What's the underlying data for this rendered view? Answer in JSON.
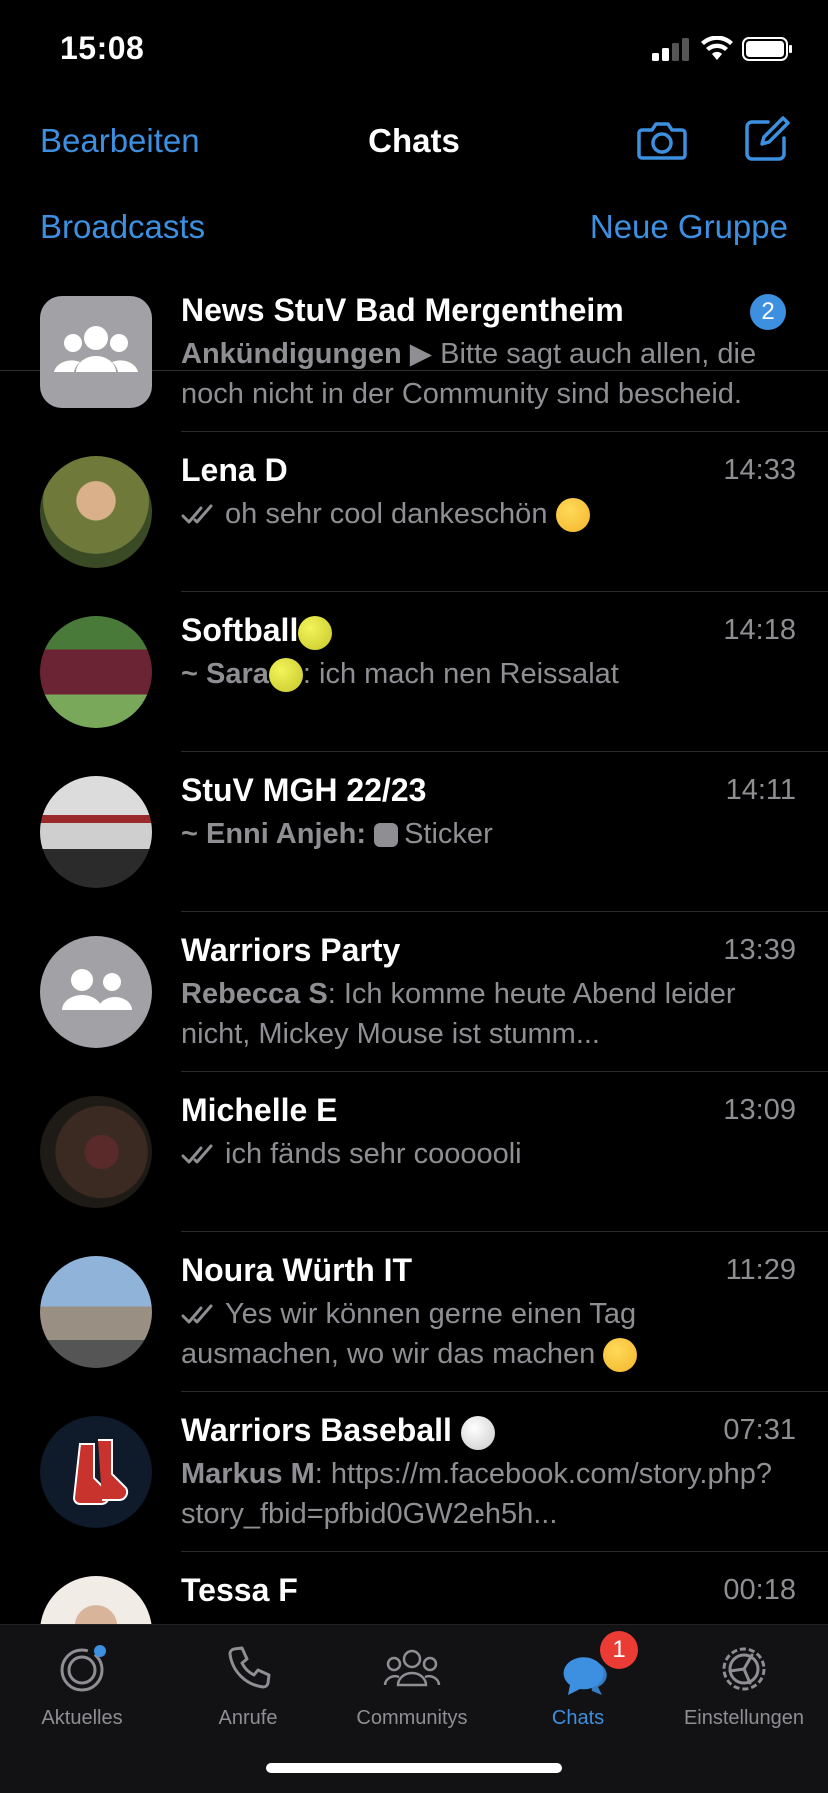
{
  "status": {
    "time": "15:08"
  },
  "nav": {
    "edit": "Bearbeiten",
    "title": "Chats",
    "broadcasts": "Broadcasts",
    "new_group": "Neue Gruppe"
  },
  "chats": [
    {
      "name": "News StuV Bad Mergentheim",
      "time": "",
      "unread": "2",
      "sender": "Ankündigungen ▶",
      "text": " Bitte sagt auch allen, die noch nicht in der Community sind bescheid."
    },
    {
      "name": "Lena D",
      "time": "14:33",
      "text": "oh sehr cool dankeschön"
    },
    {
      "name": "Softball",
      "time": "14:18",
      "sender": "~ Sara",
      "text": ": ich mach nen Reissalat"
    },
    {
      "name": "StuV MGH 22/23",
      "time": "14:11",
      "sender": "~ Enni Anjeh:",
      "text": "Sticker"
    },
    {
      "name": "Warriors Party",
      "time": "13:39",
      "sender": "Rebecca S",
      "text": ": Ich komme heute Abend leider nicht, Mickey Mouse ist stumm..."
    },
    {
      "name": "Michelle E",
      "time": "13:09",
      "text": "ich fänds sehr coooooli"
    },
    {
      "name": "Noura Würth IT",
      "time": "11:29",
      "text": "Yes wir können gerne einen Tag ausmachen, wo wir das machen"
    },
    {
      "name": "Warriors Baseball",
      "time": "07:31",
      "sender": "Markus M",
      "text": ": https://m.facebook.com/story.php?story_fbid=pfbid0GW2eh5h..."
    },
    {
      "name": "Tessa F",
      "time": "00:18",
      "text": ""
    }
  ],
  "tabs": [
    {
      "label": "Aktuelles",
      "icon": "status-icon"
    },
    {
      "label": "Anrufe",
      "icon": "phone-icon"
    },
    {
      "label": "Communitys",
      "icon": "communities-icon"
    },
    {
      "label": "Chats",
      "icon": "chats-icon",
      "badge": "1"
    },
    {
      "label": "Einstellungen",
      "icon": "settings-icon"
    }
  ],
  "colors": {
    "accent": "#3d8fe0",
    "badge": "#ea3b34",
    "muted": "#8e8e93",
    "background": "#000000"
  }
}
